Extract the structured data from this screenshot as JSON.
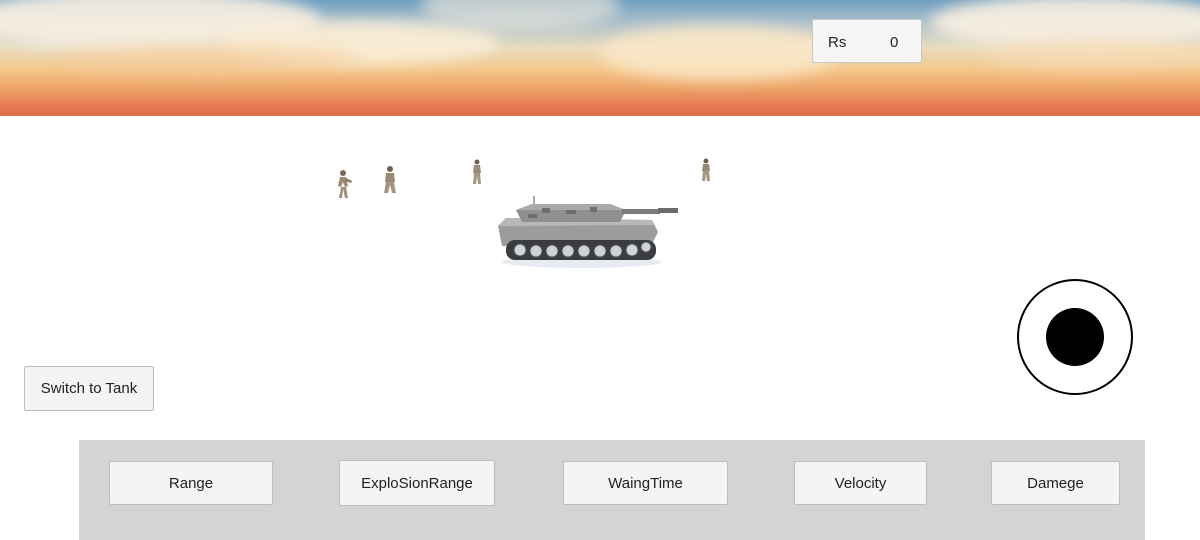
{
  "hud": {
    "currency_label": "Rs",
    "money": "0"
  },
  "controls": {
    "switch_button_label": "Switch to Tank"
  },
  "upgrades": [
    {
      "label": "Range"
    },
    {
      "label": "ExploSionRange"
    },
    {
      "label": "WaingTime"
    },
    {
      "label": "Velocity"
    },
    {
      "label": "Damege"
    }
  ],
  "colors": {
    "panel": "#d4d4d4",
    "button": "#f4f4f4",
    "joystick": "#000000",
    "sky_top": "#6e9fc0",
    "sky_horizon": "#dc6a4a"
  }
}
